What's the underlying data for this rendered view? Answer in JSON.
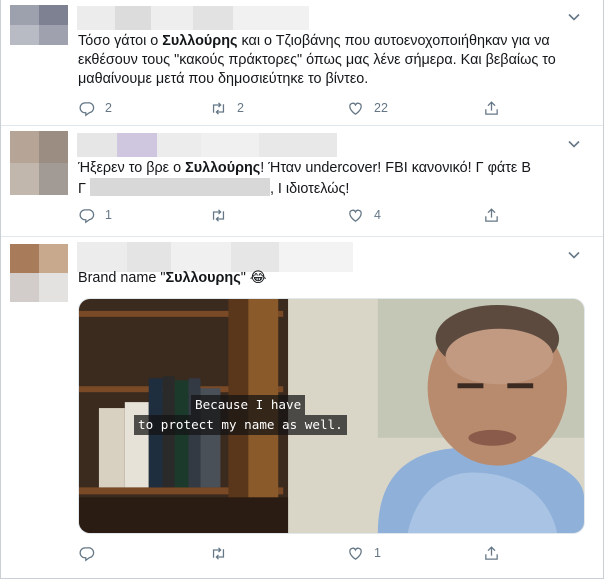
{
  "tweets": [
    {
      "text_before": "Τόσο γάτοι ο ",
      "text_bold": "Συλλούρης",
      "text_after": " και ο Τζιοβάνης που αυτοενοχοποιήθηκαν για να εκθέσουν τους \"κακούς πράκτορες\" όπως μας λένε σήμερα. Και βεβαίως το μαθαίνουμε μετά που δημοσιεύτηκε το βίντεο.",
      "replies": "2",
      "retweets": "2",
      "likes": "22"
    },
    {
      "text_before": "Ήξερεν το βρε ο ",
      "text_bold": "Συλλούρης",
      "text_after": "! Ήταν undercover! FBI κανονικό! Γ φάτε Β",
      "text_line2_start": "Γ",
      "text_line2_end": ", Ι ιδιοτελώς!",
      "replies": "1",
      "retweets": "",
      "likes": "4"
    },
    {
      "text_before": "Brand name \"",
      "text_bold": "Συλλουρης",
      "text_after": "\" 😂",
      "video_subtitle_line1": "Because I have",
      "video_subtitle_line2": "to protect my name as well.",
      "replies": "",
      "retweets": "",
      "likes": "1"
    }
  ],
  "icons": {
    "reply": "reply-icon",
    "retweet": "retweet-icon",
    "like": "heart-icon",
    "share": "share-icon",
    "menu": "chevron-down-icon"
  },
  "colors": {
    "text": "#14171a",
    "muted": "#657786",
    "divider": "#e1e8ed"
  }
}
